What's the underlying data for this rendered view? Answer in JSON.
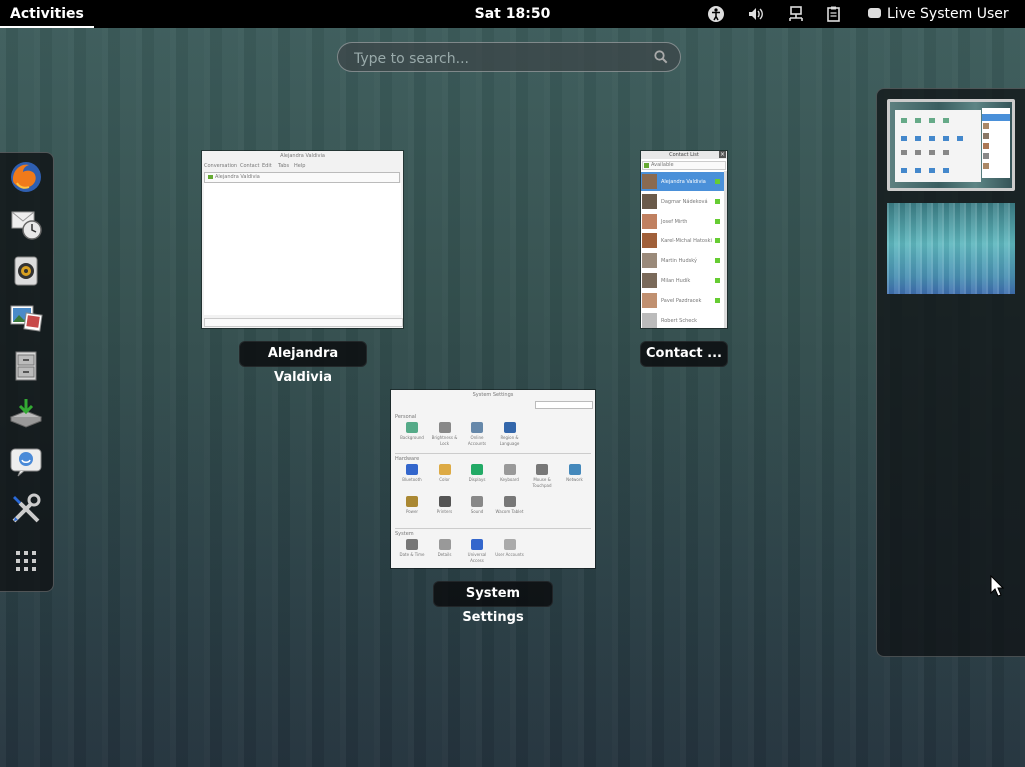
{
  "topbar": {
    "activities": "Activities",
    "clock": "Sat 18:50",
    "user": "Live System User"
  },
  "search": {
    "placeholder": "Type to search..."
  },
  "dash": {
    "items": [
      "firefox-icon",
      "evolution-icon",
      "rhythmbox-icon",
      "shotwell-icon",
      "files-icon",
      "software-install-icon",
      "empathy-icon",
      "system-tools-icon",
      "show-applications-icon"
    ]
  },
  "windows": {
    "chat": {
      "label": "Alejandra Valdivia",
      "title": "Alejandra Valdivia",
      "menu": [
        "Conversation",
        "Contact",
        "Edit",
        "Tabs",
        "Help"
      ],
      "tab": "Alejandra Valdivia"
    },
    "contacts": {
      "label": "Contact ...",
      "title": "Contact List",
      "status": "Available",
      "people": [
        "Alejandra Valdivia",
        "Dagmar Nádeková",
        "Josef Mirth",
        "Karel-Michal Hatoski",
        "Martin Hudský",
        "Milan Hudík",
        "Pavel Pazdracek",
        "Robert Scheck"
      ]
    },
    "settings": {
      "label": "System Settings",
      "title": "System Settings",
      "sections": [
        {
          "name": "Personal",
          "items": [
            "Background",
            "Brightness & Lock",
            "Online Accounts",
            "Region & Language"
          ]
        },
        {
          "name": "Hardware",
          "items": [
            "Bluetooth",
            "Color",
            "Displays",
            "Keyboard",
            "Mouse & Touchpad",
            "Network",
            "Power",
            "Printers",
            "Sound",
            "Wacom Tablet"
          ]
        },
        {
          "name": "System",
          "items": [
            "Date & Time",
            "Details",
            "Universal Access",
            "User Accounts"
          ]
        }
      ]
    }
  },
  "colors": {
    "topbar": "#000000",
    "selection": "#4a90d9"
  }
}
